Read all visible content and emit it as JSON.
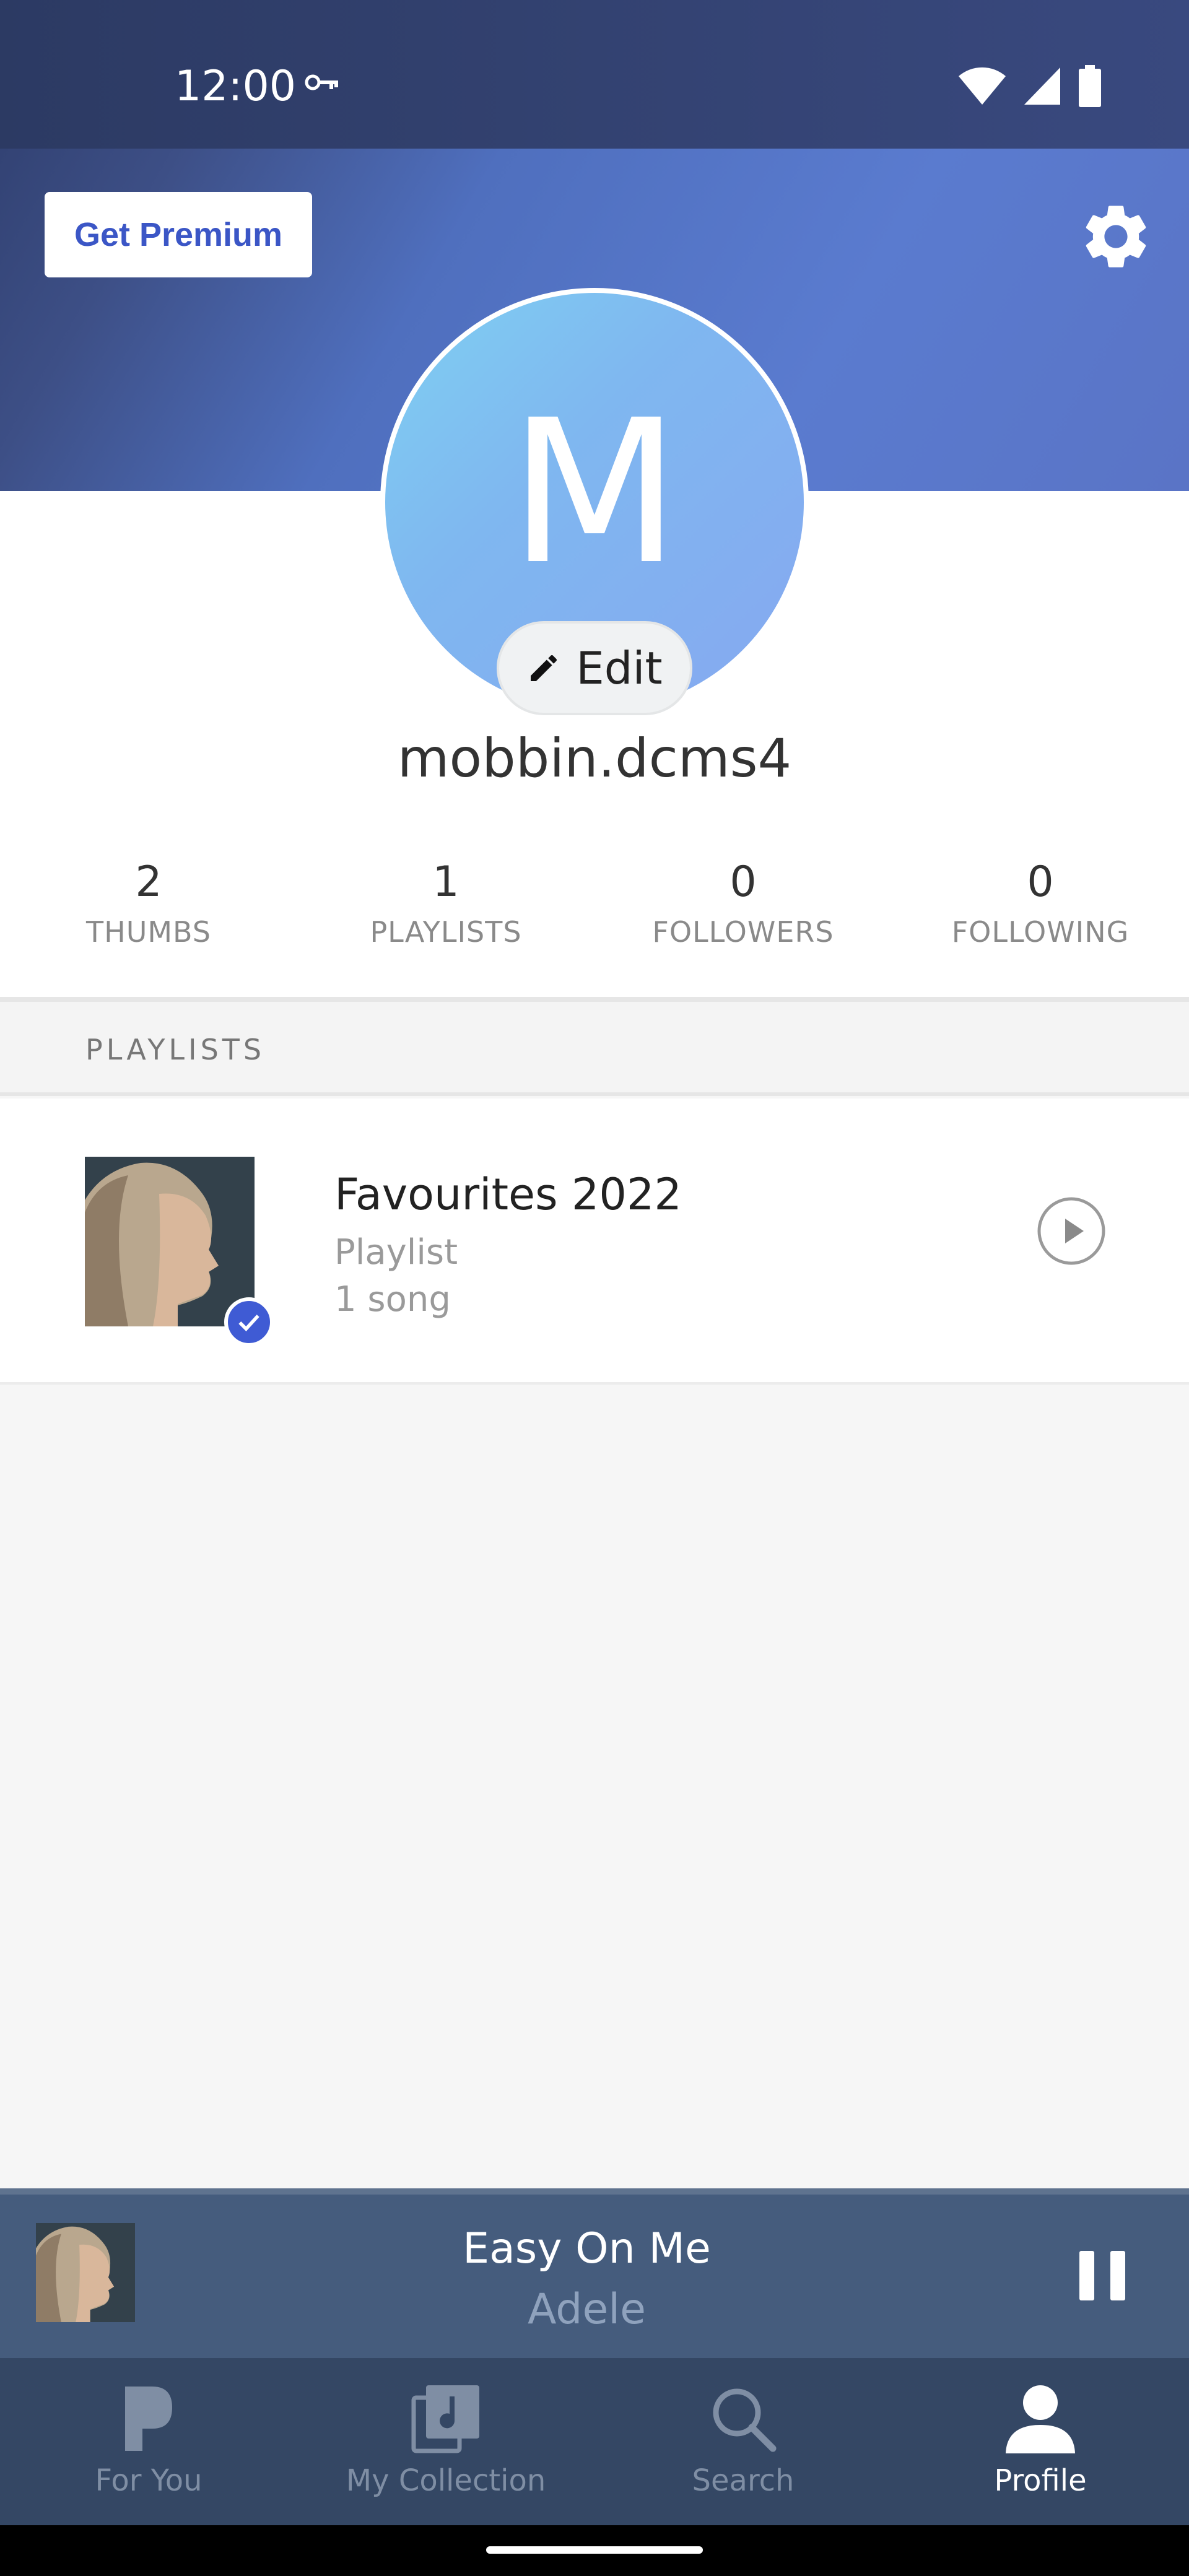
{
  "status_bar": {
    "time": "12:00"
  },
  "header": {
    "premium_button": "Get Premium",
    "settings_icon": "gear-icon"
  },
  "profile": {
    "avatar_letter": "M",
    "edit_label": "Edit",
    "username": "mobbin.dcms4",
    "stats": [
      {
        "value": "2",
        "label": "THUMBS"
      },
      {
        "value": "1",
        "label": "PLAYLISTS"
      },
      {
        "value": "0",
        "label": "FOLLOWERS"
      },
      {
        "value": "0",
        "label": "FOLLOWING"
      }
    ]
  },
  "playlists_section": {
    "title": "PLAYLISTS",
    "items": [
      {
        "title": "Favourites 2022",
        "type": "Playlist",
        "count": "1 song"
      }
    ]
  },
  "now_playing": {
    "title": "Easy On Me",
    "artist": "Adele"
  },
  "bottom_nav": {
    "items": [
      {
        "label": "For You",
        "icon": "pandora-p-icon",
        "active": false
      },
      {
        "label": "My Collection",
        "icon": "collection-music-icon",
        "active": false
      },
      {
        "label": "Search",
        "icon": "search-icon",
        "active": false
      },
      {
        "label": "Profile",
        "icon": "person-icon",
        "active": true
      }
    ]
  },
  "colors": {
    "accent": "#3b56c6",
    "header_start": "#2e3d6c",
    "header_end": "#5a7bcf",
    "nav_bg": "#344764",
    "player_bg": "#455c7d"
  }
}
